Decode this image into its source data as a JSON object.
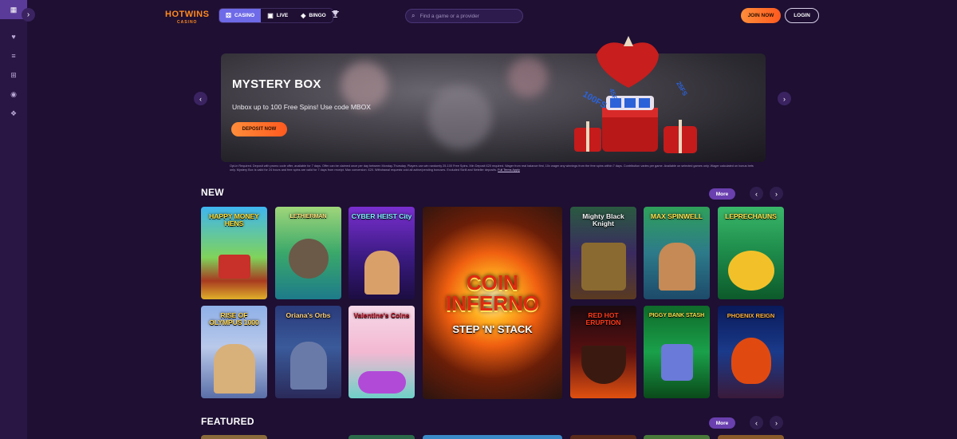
{
  "sidebar": {
    "items": [
      {
        "icon": "grid-icon",
        "glyph": "▦"
      },
      {
        "icon": "heart-icon",
        "glyph": "♥"
      },
      {
        "icon": "stack-icon",
        "glyph": "≡"
      },
      {
        "icon": "gift-icon",
        "glyph": "⊞"
      },
      {
        "icon": "chip-icon",
        "glyph": "◉"
      },
      {
        "icon": "chat-icon",
        "glyph": "❖"
      }
    ],
    "expand_glyph": "›"
  },
  "header": {
    "logo_main": "HOTWINS",
    "logo_sub": "CASINO",
    "tabs": [
      {
        "label": "CASINO",
        "icon": "dice-icon",
        "glyph": "⚄"
      },
      {
        "label": "LIVE",
        "icon": "cards-icon",
        "glyph": "▣"
      },
      {
        "label": "BINGO",
        "icon": "ball-icon",
        "glyph": "◈"
      }
    ],
    "trophy_glyph": "🏆",
    "search_placeholder": "Find a game or a provider",
    "search_glyph": "⌕",
    "join_label": "JOIN NOW",
    "login_label": "LOGIN"
  },
  "banner": {
    "title": "MYSTERY BOX",
    "subtitle": "Unbox up to 100 Free Spins! Use code MBOX",
    "cta": "DEPOSIT NOW",
    "prev_glyph": "‹",
    "next_glyph": "›",
    "terms": "Opt-in Required. Deposit with promo code offer, available for 7 days. Offer can be claimed once per day between Monday-Thursday. Players can win randomly 25-100 Free Spins. Min Deposit £20 required. Wager from real balance first, 10x wager any winnings from the free spins within 7 days. Contribution varies per game. Available on selected games only. Wager calculated on bonus bets only. Mystery Box is valid for 24 hours and free spins are valid for 7 days from receipt. Max conversion: £20. Withdrawal requests void all active/pending bonuses. Excluded Skrill and Neteller deposits.",
    "terms_link": "Full Terms Apply"
  },
  "sections": {
    "new": {
      "title": "NEW",
      "more": "More",
      "prev": "‹",
      "next": "›"
    },
    "featured": {
      "title": "FEATURED",
      "more": "More",
      "prev": "‹",
      "next": "›"
    }
  },
  "games": {
    "happy_money_hens": "HAPPY MONEY HENS",
    "the_ethierman": "LETHIERMAN",
    "cyber_heist_city": "CYBER HEIST City",
    "coin_inferno": "COIN INFERNO",
    "coin_inferno_sub": "STEP 'N' STACK",
    "mighty_black_knight": "Mighty Black Knight",
    "max_spinwell": "MAX SPINWELL",
    "leprechauns": "LEPRECHAUNS",
    "rise_of_olympus": "RISE OF OLYMPUS 1000",
    "orianas_orbs": "Oriana's Orbs",
    "valentines_coins": "Valentine's Coins",
    "red_hot_eruption": "RED HOT ERUPTION",
    "piggy_bank_stash": "PIGGY BANK STASH",
    "phoenix_reign": "PHOENIX REIGN"
  }
}
